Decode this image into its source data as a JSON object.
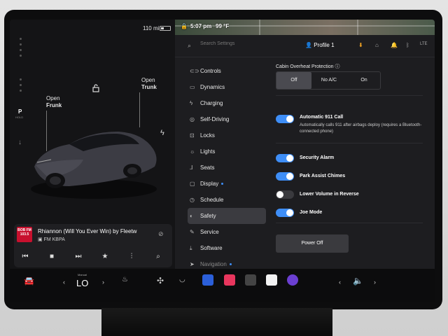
{
  "status": {
    "range": "110 mi",
    "time": "5:07 pm",
    "temperature": "99 °F"
  },
  "car": {
    "gear": "P",
    "gear_hold": "HOLD",
    "frunk": {
      "line1": "Open",
      "line2": "Frunk"
    },
    "trunk": {
      "line1": "Open",
      "line2": "Trunk"
    }
  },
  "media": {
    "station_logo": "BOB FM 103.5",
    "song": "Rhiannon (Will You Ever Win) by Fleetw",
    "station": "FM KBPA",
    "icons": [
      "prev-icon",
      "stop-icon",
      "next-icon",
      "favorite-icon",
      "equalizer-icon",
      "search-icon"
    ]
  },
  "topbar": {
    "search_placeholder": "Search Settings",
    "profile": "Profile 1"
  },
  "nav": {
    "items": [
      {
        "label": "Controls",
        "icon": "toggle-icon"
      },
      {
        "label": "Dynamics",
        "icon": "car-icon"
      },
      {
        "label": "Charging",
        "icon": "bolt-icon"
      },
      {
        "label": "Self-Driving",
        "icon": "steering-icon"
      },
      {
        "label": "Locks",
        "icon": "lock-icon"
      },
      {
        "label": "Lights",
        "icon": "sun-icon"
      },
      {
        "label": "Seats",
        "icon": "seat-icon"
      },
      {
        "label": "Display",
        "icon": "display-icon"
      },
      {
        "label": "Schedule",
        "icon": "clock-icon"
      },
      {
        "label": "Safety",
        "icon": "safety-icon"
      },
      {
        "label": "Service",
        "icon": "wrench-icon"
      },
      {
        "label": "Software",
        "icon": "download-icon"
      },
      {
        "label": "Navigation",
        "icon": "nav-icon"
      }
    ]
  },
  "safety": {
    "cabin_label": "Cabin Overheat Protection",
    "cabin_options": [
      "Off",
      "No A/C",
      "On"
    ],
    "cabin_selected": "Off",
    "auto911": {
      "label": "Automatic 911 Call",
      "desc": "Automatically calls 911 after airbags deploy (requires a Bluetooth-connected phone)",
      "on": true
    },
    "security_alarm": {
      "label": "Security Alarm",
      "on": true
    },
    "park_assist": {
      "label": "Park Assist Chimes",
      "on": true
    },
    "lower_volume": {
      "label": "Lower Volume in Reverse",
      "on": false
    },
    "joe_mode": {
      "label": "Joe Mode",
      "on": true
    },
    "power_off": "Power Off"
  },
  "dock": {
    "temp_mode": "Manual",
    "temp": "LO"
  },
  "colors": {
    "accent": "#3e8ef7",
    "panel": "#1d1d20",
    "selected_nav": "#3b3b40"
  }
}
